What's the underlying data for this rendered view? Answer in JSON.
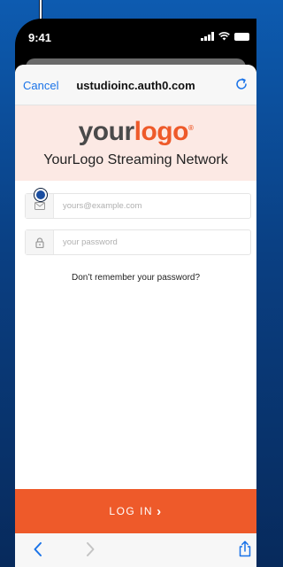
{
  "status_bar": {
    "time": "9:41"
  },
  "browser": {
    "cancel_label": "Cancel",
    "site_title": "ustudioinc.auth0.com"
  },
  "brand": {
    "logo_part1": "your",
    "logo_part2": "logo",
    "logo_mark": "®",
    "network_name": "YourLogo Streaming Network"
  },
  "form": {
    "email_placeholder": "yours@example.com",
    "password_placeholder": "your password",
    "forgot_label": "Don’t remember your password?",
    "login_label": "LOG IN",
    "login_arrow": "›"
  },
  "colors": {
    "accent": "#ee5a2a",
    "header_bg": "#fce9e4",
    "link": "#1a73e8"
  },
  "icons": [
    "reload-icon",
    "mail-icon",
    "lock-icon",
    "back-arrow-icon",
    "forward-arrow-icon",
    "share-icon"
  ]
}
